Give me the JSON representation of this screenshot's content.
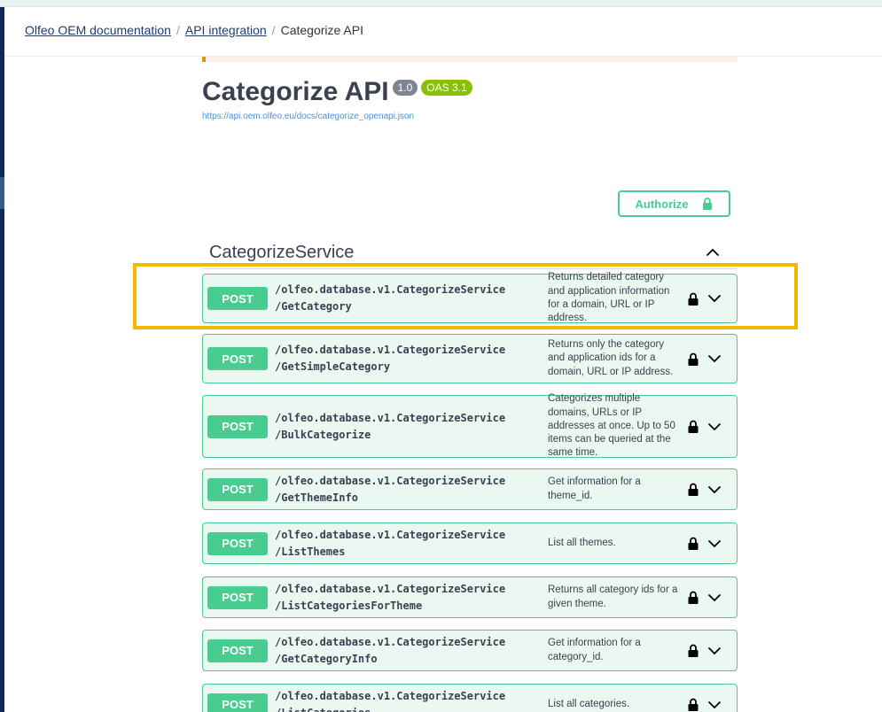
{
  "breadcrumb": {
    "items": [
      "Olfeo OEM documentation",
      "API integration"
    ],
    "current": "Categorize API",
    "separator": "/"
  },
  "header": {
    "title": "Categorize API",
    "version_badge": "1.0",
    "oas_badge": "OAS 3.1",
    "spec_url": "https://api.oem.olfeo.eu/docs/categorize_openapi.json"
  },
  "authorize": {
    "label": "Authorize",
    "icon": "lock-icon"
  },
  "tag": {
    "name": "CategorizeService",
    "icon": "chevron-up-icon"
  },
  "operations": [
    {
      "method": "POST",
      "path_line1": "/olfeo.database.v1.CategorizeService",
      "path_line2": "/GetCategory",
      "summary": "Returns detailed category and application information for a domain, URL or IP address."
    },
    {
      "method": "POST",
      "path_line1": "/olfeo.database.v1.CategorizeService",
      "path_line2": "/GetSimpleCategory",
      "summary": "Returns only the category and application ids for a domain, URL or IP address."
    },
    {
      "method": "POST",
      "path_line1": "/olfeo.database.v1.CategorizeService",
      "path_line2": "/BulkCategorize",
      "summary": "Categorizes multiple domains, URLs or IP addresses at once. Up to 50 items can be queried at the same time."
    },
    {
      "method": "POST",
      "path_line1": "/olfeo.database.v1.CategorizeService",
      "path_line2": "/GetThemeInfo",
      "summary": "Get information for a theme_id."
    },
    {
      "method": "POST",
      "path_line1": "/olfeo.database.v1.CategorizeService",
      "path_line2": "/ListThemes",
      "summary": "List all themes."
    },
    {
      "method": "POST",
      "path_line1": "/olfeo.database.v1.CategorizeService",
      "path_line2": "/ListCategoriesForTheme",
      "summary": "Returns all category ids for a given theme."
    },
    {
      "method": "POST",
      "path_line1": "/olfeo.database.v1.CategorizeService",
      "path_line2": "/GetCategoryInfo",
      "summary": "Get information for a category_id."
    },
    {
      "method": "POST",
      "path_line1": "/olfeo.database.v1.CategorizeService",
      "path_line2": "/ListCategories",
      "summary": "List all categories."
    }
  ],
  "colors": {
    "post": "#49cc90",
    "post_bg": "#ebf7f1",
    "highlight": "#f5b800",
    "link": "#1f3c6e"
  }
}
